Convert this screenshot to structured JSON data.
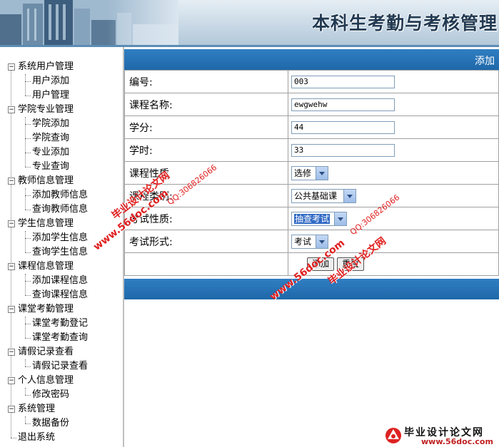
{
  "header": {
    "title": "本科生考勤与考核管理"
  },
  "sidebar": {
    "groups": [
      {
        "label": "系统用户管理",
        "children": [
          "用户添加",
          "用户管理"
        ]
      },
      {
        "label": "学院专业管理",
        "children": [
          "学院添加",
          "学院查询",
          "专业添加",
          "专业查询"
        ]
      },
      {
        "label": "教师信息管理",
        "children": [
          "添加教师信息",
          "查询教师信息"
        ]
      },
      {
        "label": "学生信息管理",
        "children": [
          "添加学生信息",
          "查询学生信息"
        ]
      },
      {
        "label": "课程信息管理",
        "children": [
          "添加课程信息",
          "查询课程信息"
        ]
      },
      {
        "label": "课堂考勤管理",
        "children": [
          "课堂考勤登记",
          "课堂考勤查询"
        ]
      },
      {
        "label": "请假记录查看",
        "children": [
          "请假记录查看"
        ]
      },
      {
        "label": "个人信息管理",
        "children": [
          "修改密码"
        ]
      },
      {
        "label": "系统管理",
        "children": [
          "数据备份"
        ]
      }
    ],
    "exit_label": "退出系统",
    "expanded_glyph": "−"
  },
  "main": {
    "top_bar_text": "添加",
    "fields": {
      "code_label": "编号:",
      "code_value": "003",
      "name_label": "课程名称:",
      "name_value": "ewgwehw",
      "credit_label": "学分:",
      "credit_value": "44",
      "hours_label": "学时:",
      "hours_value": "33",
      "nature_label": "课程性质",
      "nature_value": "选修",
      "category_label": "课程类别:",
      "category_value": "公共基础课",
      "exam_nature_label": "考试性质:",
      "exam_nature_value": "抽查考试",
      "exam_form_label": "考试形式:",
      "exam_form_value": "考试"
    },
    "buttons": {
      "add": "添加",
      "reset": "重置"
    }
  },
  "watermark": {
    "site_cn": "毕业设计论文网",
    "site_url": "www.56doc.com",
    "qq": "QQ:306826066",
    "logo_url": "www.56doc.com"
  },
  "colors": {
    "bar_blue": "#1f68a9",
    "watermark_red": "#e02020"
  }
}
